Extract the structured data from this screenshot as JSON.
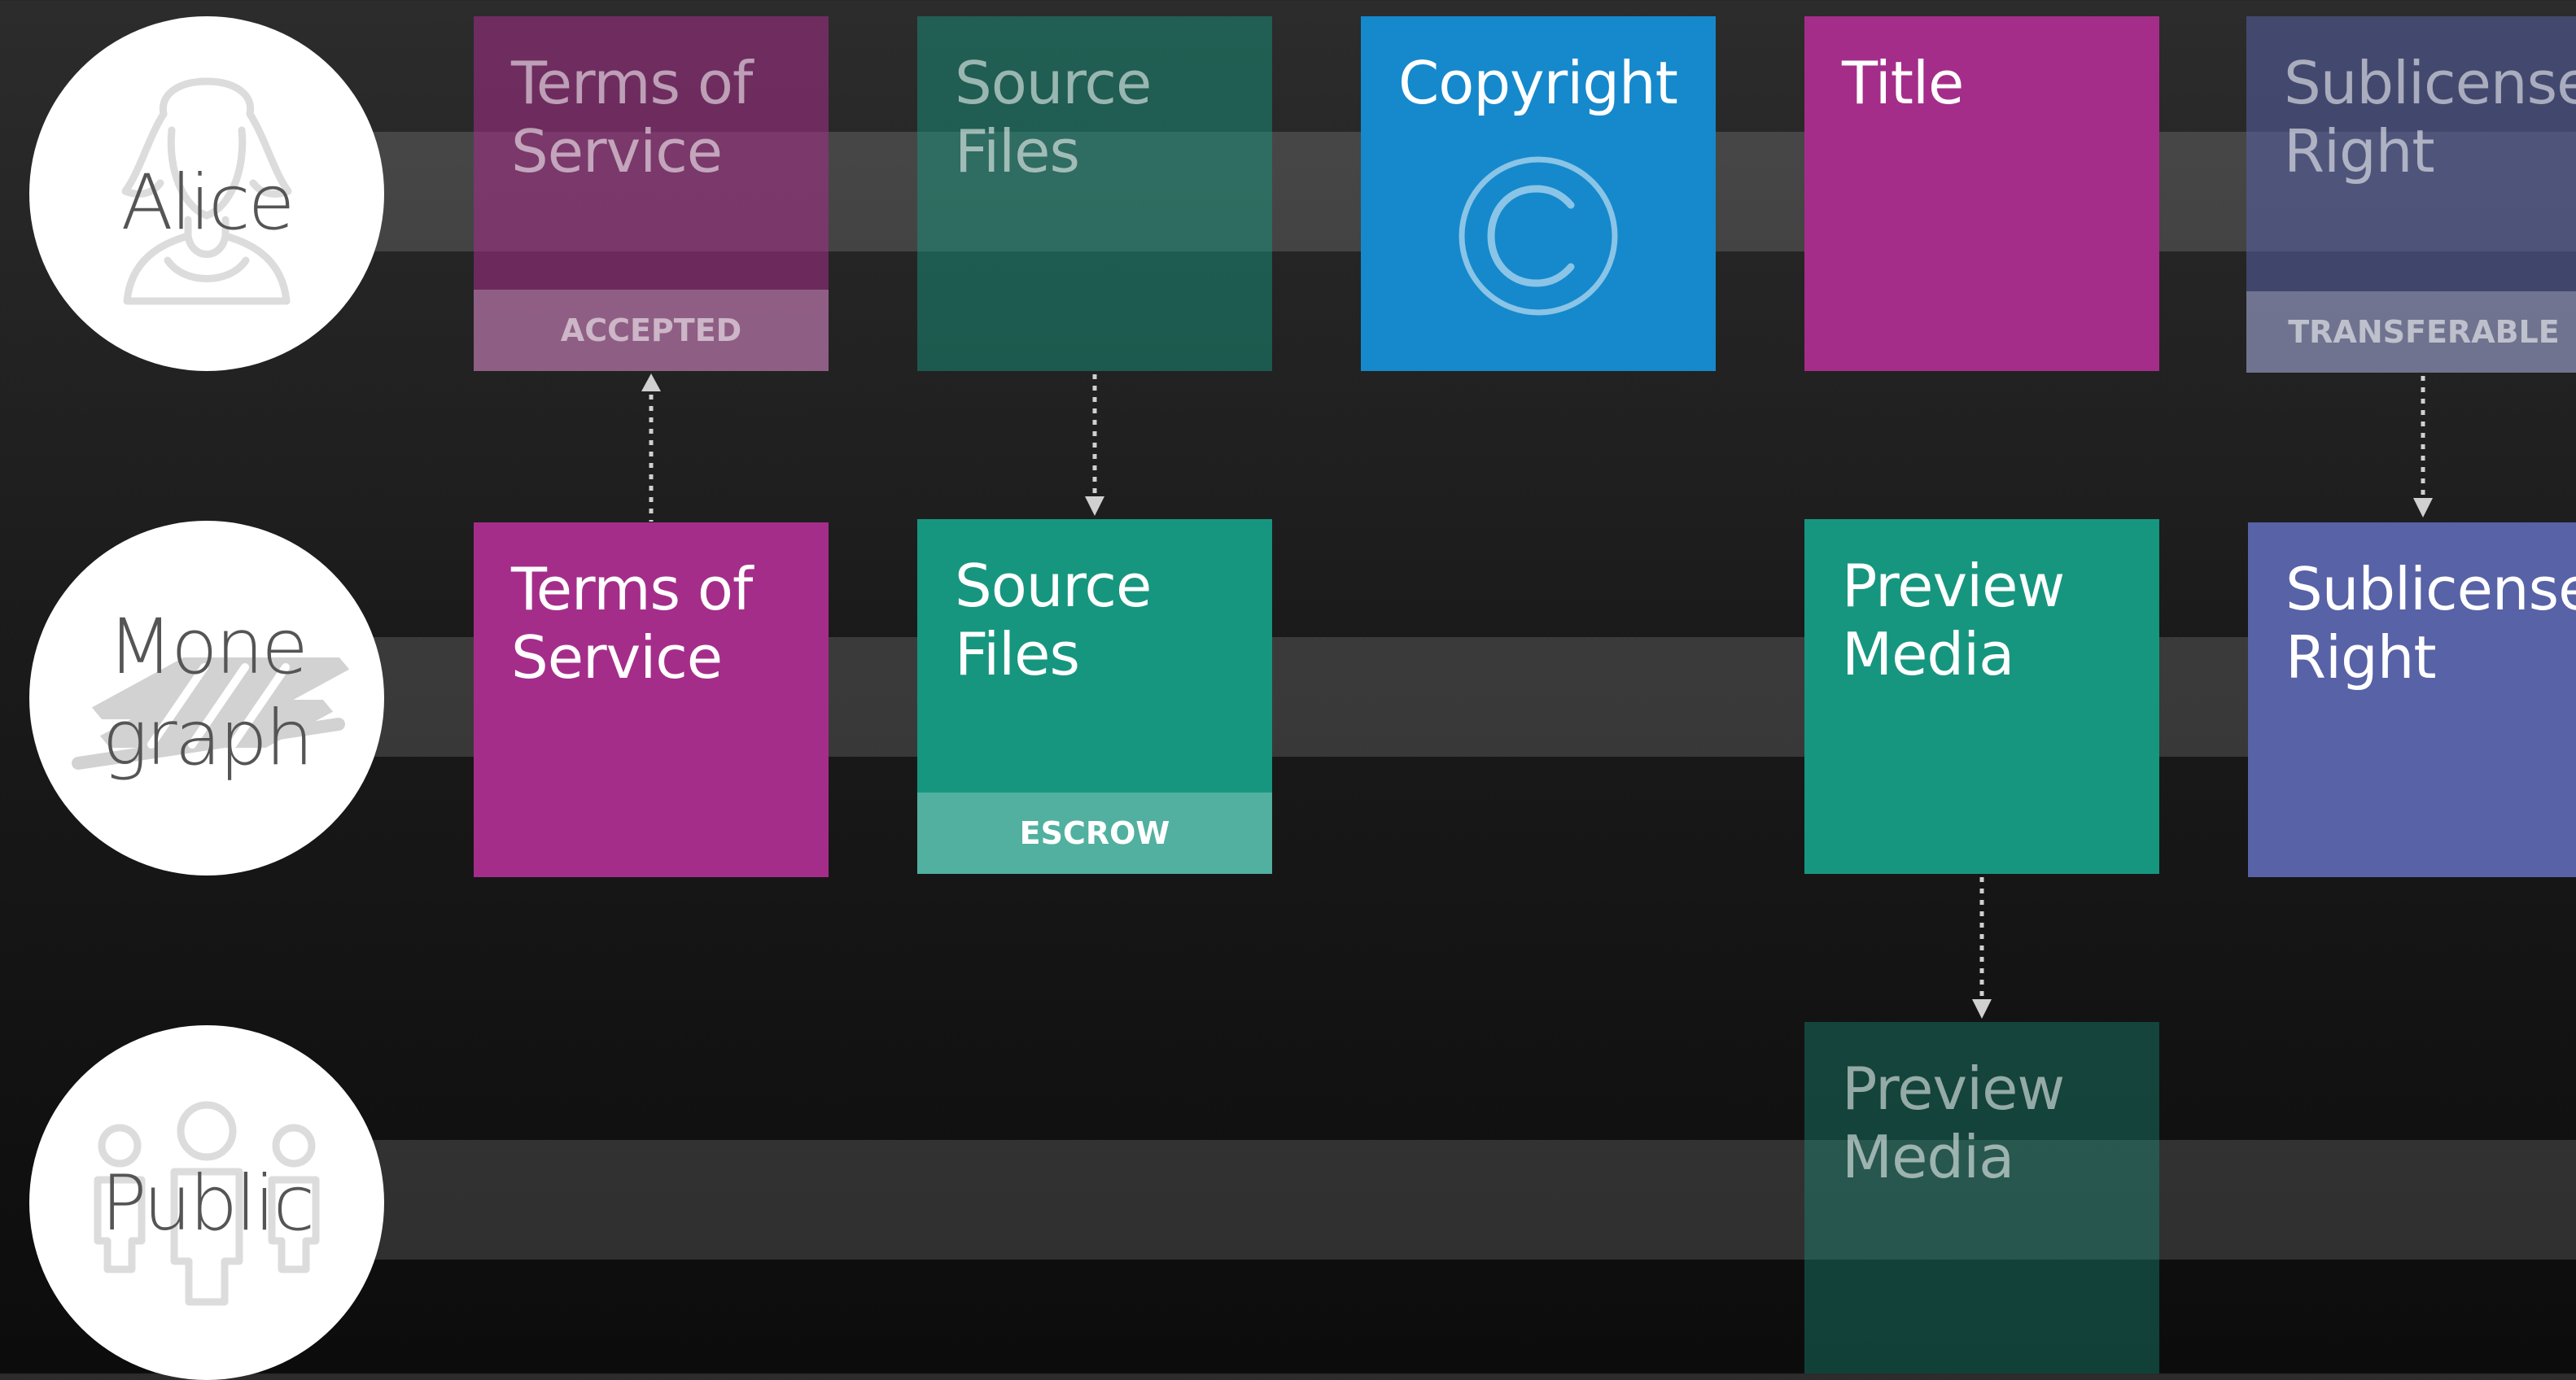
{
  "lanes": [
    {
      "name": "Alice",
      "icon": "person-icon"
    },
    {
      "name": "Mone\ngraph",
      "icon": "monegraph-logo-icon"
    },
    {
      "name": "Public",
      "icon": "people-icon"
    }
  ],
  "tiles": {
    "alice_tos": {
      "title": "Terms of\nService",
      "tag": "ACCEPTED"
    },
    "alice_source": {
      "title": "Source\nFiles"
    },
    "alice_copyright": {
      "title": "Copyright",
      "icon": "copyright-icon"
    },
    "alice_title": {
      "title": "Title"
    },
    "alice_sublicense": {
      "title": "Sublicense\nRight",
      "tag": "TRANSFERABLE"
    },
    "mono_tos": {
      "title": "Terms of\nService"
    },
    "mono_source": {
      "title": "Source\nFiles",
      "tag": "ESCROW"
    },
    "mono_preview": {
      "title": "Preview\nMedia"
    },
    "mono_sublicense": {
      "title": "Sublicense\nRight"
    },
    "public_preview": {
      "title": "Preview\nMedia"
    }
  },
  "colors": {
    "magenta": "#a52d8a",
    "teal": "#17967f",
    "blue": "#1589cc",
    "indigo": "#5862a6",
    "faded_magenta": "#6a2d5c",
    "faded_teal": "#1e5b52",
    "faded_indigo": "#3e4568",
    "faded_public_teal": "#154a42"
  }
}
